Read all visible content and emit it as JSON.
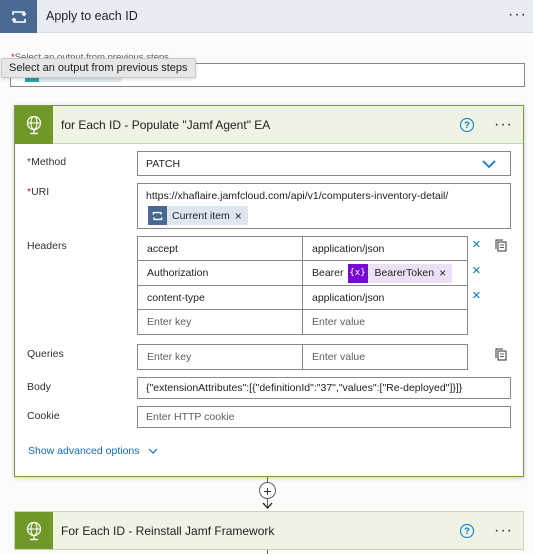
{
  "apply_each": {
    "title": "Apply to each ID",
    "select_label": "Select an output from previous steps",
    "select_token": "groupMembershi",
    "tooltip": "Select an output from previous steps"
  },
  "http_action": {
    "title": "for Each ID - Populate \"Jamf Agent\" EA",
    "method_label": "Method",
    "method_value": "PATCH",
    "uri_label": "URI",
    "uri_value": "https://xhaflaire.jamfcloud.com/api/v1/computers-inventory-detail/",
    "uri_token": "Current item",
    "headers_label": "Headers",
    "headers": [
      {
        "key": "accept",
        "value": "application/json"
      },
      {
        "key": "Authorization",
        "value_prefix": "Bearer",
        "value_token": "BearerToken"
      },
      {
        "key": "content-type",
        "value": "application/json"
      }
    ],
    "key_placeholder": "Enter key",
    "value_placeholder": "Enter value",
    "queries_label": "Queries",
    "body_label": "Body",
    "body_value": "{\"extensionAttributes\":[{\"definitionId\":\"37\",\"values\":[\"Re-deployed\"]}]}",
    "cookie_label": "Cookie",
    "cookie_placeholder": "Enter HTTP cookie",
    "advanced_options": "Show advanced options",
    "required_mark": "*"
  },
  "next_action": {
    "title": "For Each ID - Reinstall Jamf Framework"
  },
  "icons": {
    "loop": "loop-icon",
    "globe": "globe-icon",
    "help": "help-icon",
    "more": "more-icon",
    "chevron": "chevron-down-icon",
    "copy": "copy-icon",
    "delete": "close-icon",
    "plus": "plus-icon",
    "expression": "expression-icon"
  },
  "glyphs": {
    "more": "···",
    "help": "?",
    "plus": "+",
    "close": "×",
    "expression": "{x}"
  },
  "colors": {
    "loop_blue": "#486991",
    "http_green": "#709727",
    "accent_blue": "#0078d4",
    "token_purple": "#770bd6"
  }
}
